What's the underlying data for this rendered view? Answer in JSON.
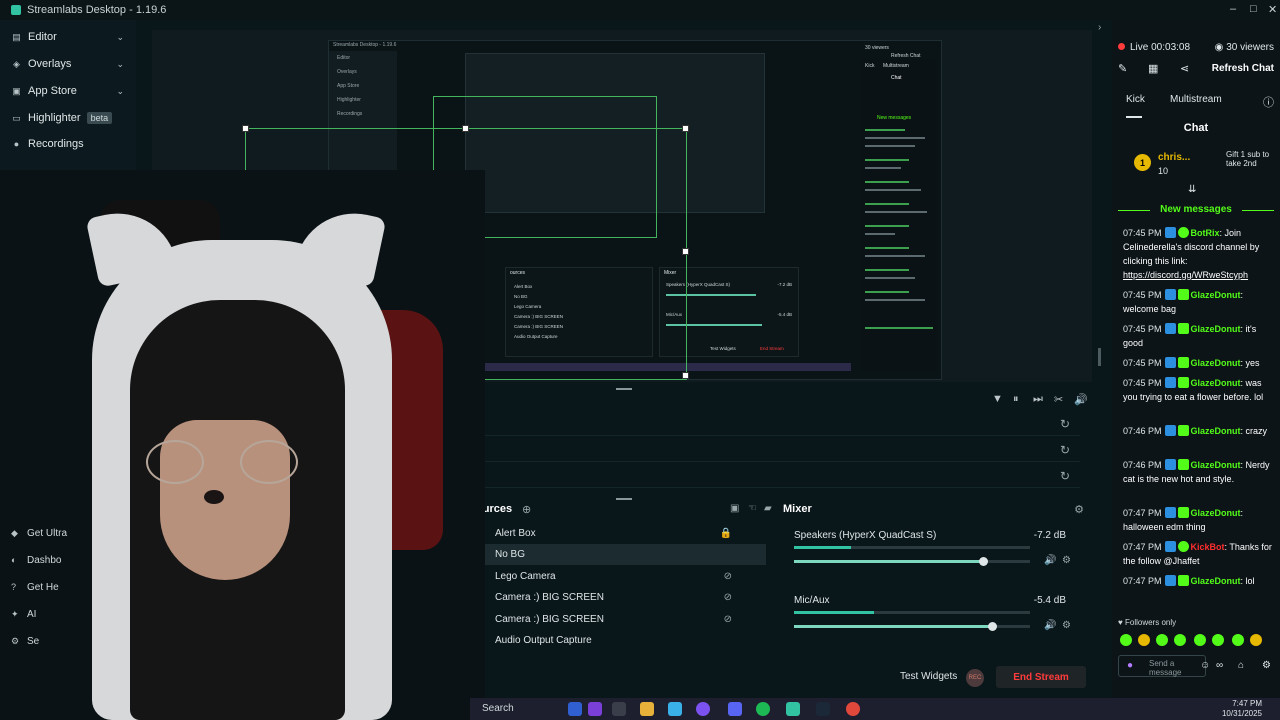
{
  "window": {
    "title": "Streamlabs Desktop - 1.19.6",
    "minimize": "–",
    "maximize": "□",
    "close": "✕"
  },
  "sidebar": {
    "items": [
      {
        "label": "Editor",
        "icon": "editor-icon",
        "glyph": "▤",
        "chevron": "⌄"
      },
      {
        "label": "Overlays",
        "icon": "overlays-icon",
        "glyph": "◈",
        "chevron": "⌄"
      },
      {
        "label": "App Store",
        "icon": "app-store-icon",
        "glyph": "▣",
        "chevron": "⌄"
      },
      {
        "label": "Highlighter",
        "icon": "highlighter-icon",
        "glyph": "▭",
        "badge": "beta"
      },
      {
        "label": "Recordings",
        "icon": "recordings-icon",
        "glyph": "●"
      }
    ],
    "bottom": [
      {
        "label": "Get Ultra",
        "icon": "ultra-icon",
        "glyph": "◆"
      },
      {
        "label": "Dashbo",
        "icon": "dashboard-icon",
        "glyph": "◐"
      },
      {
        "label": "Get He",
        "icon": "help-icon",
        "glyph": "?"
      },
      {
        "label": "AI",
        "icon": "ai-icon",
        "glyph": "✦"
      },
      {
        "label": "Se",
        "icon": "settings-icon",
        "glyph": "⚙"
      }
    ]
  },
  "nested": {
    "title": "Streamlabs Desktop - 1.19.6",
    "items": [
      "Editor",
      "Overlays",
      "App Store",
      "Highlighter",
      "Recordings"
    ],
    "sources_label": "ources",
    "mixer_label": "Mixer",
    "sources": [
      "Alert Box",
      "No BG",
      "Lego Camera",
      "Camera :) BIG SCREEN",
      "Camera :) BIG SCREEN",
      "Audio Output Capture"
    ],
    "mixer": [
      {
        "name": "Speakers (HyperX QuadCast S)",
        "db": "-7.2 dB"
      },
      {
        "name": "Mic/Aux",
        "db": "-5.4 dB"
      }
    ],
    "test_widgets": "Test Widgets",
    "end_stream": "End Stream",
    "chat_title": "Chat",
    "chat_viewers": "30 viewers",
    "refresh": "Refresh Chat",
    "new_messages": "New messages",
    "kick": "Kick",
    "multistream": "Multistream"
  },
  "toolbar": {
    "icons": [
      "filter-icon",
      "pause-icon",
      "next-icon",
      "mixer-settings-icon",
      "volume-icon"
    ],
    "glyphs": [
      "▼",
      "⏸",
      "⏭",
      "✂",
      "🔊"
    ]
  },
  "scenes": {
    "reload": "↻"
  },
  "sources": {
    "header": "ources",
    "add": "⊕",
    "items": [
      {
        "label": "Alert Box",
        "vis": "🔒",
        "selected": false
      },
      {
        "label": "No BG",
        "vis": "",
        "selected": true
      },
      {
        "label": "Lego Camera",
        "vis": "⊘",
        "selected": false
      },
      {
        "label": "Camera :) BIG SCREEN",
        "vis": "⊘",
        "selected": false
      },
      {
        "label": "Camera :) BIG SCREEN",
        "vis": "⊘",
        "selected": false
      },
      {
        "label": "Audio Output Capture",
        "vis": "",
        "selected": false
      }
    ]
  },
  "mixer": {
    "header": "Mixer",
    "channels": [
      {
        "name": "Speakers (HyperX QuadCast S)",
        "db": "-7.2 dB",
        "meter": 0.24,
        "fader": 0.8
      },
      {
        "name": "Mic/Aux",
        "db": "-5.4 dB",
        "meter": 0.34,
        "fader": 0.84
      }
    ]
  },
  "footer": {
    "test_widgets": "Test Widgets",
    "rec": "REC",
    "end_stream": "End Stream"
  },
  "taskbar": {
    "search": "Search",
    "time": "7:47 PM",
    "date": "10/31/2025"
  },
  "chat": {
    "live": "Live 00:03:08",
    "viewers": "30 viewers",
    "refresh": "Refresh Chat",
    "tabs": [
      "Kick",
      "Multistream"
    ],
    "header": "Chat",
    "pinned": {
      "badge": "1",
      "user": "chris...",
      "count": "10",
      "gift": "Gift 1 sub to take 2nd"
    },
    "new_messages": "New messages",
    "messages": [
      {
        "time": "07:45 PM",
        "user": "BotRix",
        "text": ": Join Celinederella's discord channel by clicking this link: ",
        "link": "https://discord.gg/WRweStcyph",
        "color": "#53fc18"
      },
      {
        "time": "07:45 PM",
        "user": "GlazeDonut",
        "text": ": welcome bag",
        "link": "",
        "color": "#53fc18"
      },
      {
        "time": "07:45 PM",
        "user": "GlazeDonut",
        "text": ": it's good",
        "link": "",
        "color": "#53fc18"
      },
      {
        "time": "07:45 PM",
        "user": "GlazeDonut",
        "text": ": yes",
        "link": "",
        "color": "#53fc18"
      },
      {
        "time": "07:45 PM",
        "user": "GlazeDonut",
        "text": ": was you trying to eat a flower before. lol",
        "link": "",
        "color": "#53fc18"
      },
      {
        "time": "07:46 PM",
        "user": "GlazeDonut",
        "text": ": crazy",
        "link": "",
        "color": "#53fc18"
      },
      {
        "time": "07:46 PM",
        "user": "GlazeDonut",
        "text": ": Nerdy cat is the new hot and style.",
        "link": "",
        "color": "#53fc18"
      },
      {
        "time": "07:47 PM",
        "user": "GlazeDonut",
        "text": ": halloween edm thing",
        "link": "",
        "color": "#53fc18"
      },
      {
        "time": "07:47 PM",
        "user": "KickBot",
        "text": ": Thanks for the follow @Jhaffet",
        "link": "",
        "color": "#ff2d2d"
      },
      {
        "time": "07:47 PM",
        "user": "GlazeDonut",
        "text": ": lol",
        "link": "",
        "color": "#53fc18"
      }
    ],
    "followers_only": "Followers only",
    "placeholder": "Send a message",
    "accent": "#53fc18"
  }
}
